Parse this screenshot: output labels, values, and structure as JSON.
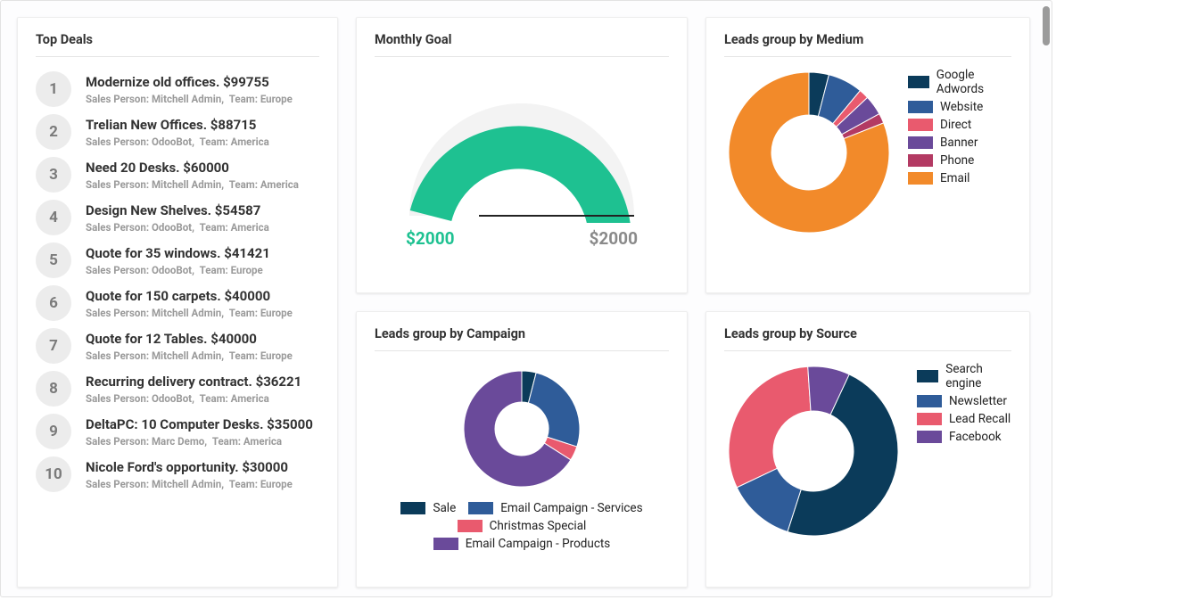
{
  "cards": {
    "top_deals": {
      "title": "Top Deals",
      "meta_labels": {
        "sales_person": "Sales Person:",
        "team": "Team:"
      },
      "items": [
        {
          "rank": "1",
          "title": "Modernize old offices. $99755",
          "sales_person": "Mitchell Admin",
          "team": "Europe"
        },
        {
          "rank": "2",
          "title": "Trelian New Offices. $88715",
          "sales_person": "OdooBot",
          "team": "America"
        },
        {
          "rank": "3",
          "title": "Need 20 Desks. $60000",
          "sales_person": "Mitchell Admin",
          "team": "America"
        },
        {
          "rank": "4",
          "title": "Design New Shelves. $54587",
          "sales_person": "OdooBot",
          "team": "America"
        },
        {
          "rank": "5",
          "title": "Quote for 35 windows. $41421",
          "sales_person": "OdooBot",
          "team": "Europe"
        },
        {
          "rank": "6",
          "title": "Quote for 150 carpets. $40000",
          "sales_person": "Mitchell Admin",
          "team": "Europe"
        },
        {
          "rank": "7",
          "title": "Quote for 12 Tables. $40000",
          "sales_person": "Mitchell Admin",
          "team": "Europe"
        },
        {
          "rank": "8",
          "title": "Recurring delivery contract. $36221",
          "sales_person": "OdooBot",
          "team": "America"
        },
        {
          "rank": "9",
          "title": "DeltaPC: 10 Computer Desks. $35000",
          "sales_person": "Marc Demo",
          "team": "America"
        },
        {
          "rank": "10",
          "title": "Nicole Ford's opportunity. $30000",
          "sales_person": "Mitchell Admin",
          "team": "Europe"
        }
      ]
    },
    "monthly_goal": {
      "title": "Monthly Goal",
      "value_label": "$2000",
      "target_label": "$2000",
      "percent": 0.92
    },
    "leads_medium": {
      "title": "Leads group by Medium"
    },
    "leads_campaign": {
      "title": "Leads group by Campaign"
    },
    "leads_source": {
      "title": "Leads group by Source"
    }
  },
  "colors": {
    "navy": "#0b3b5a",
    "blue": "#2f5c99",
    "red": "#e95a6e",
    "purple": "#6a4a9a",
    "magenta": "#b33a63",
    "orange": "#f28a2a",
    "teal": "#1ec191",
    "grey": "#8a8a8a"
  },
  "chart_data": [
    {
      "id": "monthly_goal",
      "type": "gauge",
      "title": "Monthly Goal",
      "value": 2000,
      "target": 2000,
      "value_label": "$2000",
      "target_label": "$2000",
      "fill_color": "#1ec191"
    },
    {
      "id": "leads_medium",
      "type": "donut",
      "title": "Leads group by Medium",
      "series": [
        {
          "name": "Google Adwords",
          "value": 4,
          "color": "#0b3b5a"
        },
        {
          "name": "Website",
          "value": 7,
          "color": "#2f5c99"
        },
        {
          "name": "Direct",
          "value": 2,
          "color": "#e95a6e"
        },
        {
          "name": "Banner",
          "value": 4,
          "color": "#6a4a9a"
        },
        {
          "name": "Phone",
          "value": 2,
          "color": "#b33a63"
        },
        {
          "name": "Email",
          "value": 81,
          "color": "#f28a2a"
        }
      ]
    },
    {
      "id": "leads_campaign",
      "type": "donut",
      "title": "Leads group by Campaign",
      "series": [
        {
          "name": "Sale",
          "value": 4,
          "color": "#0b3b5a"
        },
        {
          "name": "Email Campaign - Services",
          "value": 26,
          "color": "#2f5c99"
        },
        {
          "name": "Christmas Special",
          "value": 4,
          "color": "#e95a6e"
        },
        {
          "name": "Email Campaign - Products",
          "value": 66,
          "color": "#6a4a9a"
        }
      ]
    },
    {
      "id": "leads_source",
      "type": "donut",
      "title": "Leads group by Source",
      "series": [
        {
          "name": "Search engine",
          "value": 48,
          "color": "#0b3b5a"
        },
        {
          "name": "Newsletter",
          "value": 13,
          "color": "#2f5c99"
        },
        {
          "name": "Lead Recall",
          "value": 31,
          "color": "#e95a6e"
        },
        {
          "name": "Facebook",
          "value": 8,
          "color": "#6a4a9a"
        }
      ]
    }
  ]
}
